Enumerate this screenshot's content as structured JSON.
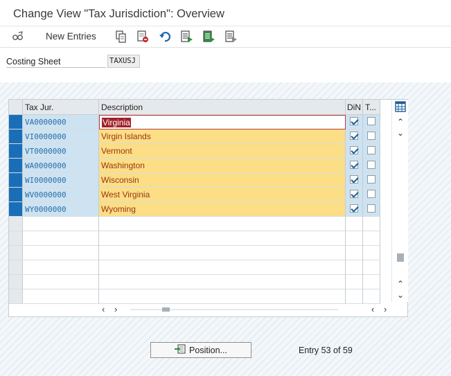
{
  "window": {
    "title": "Change View \"Tax Jurisdiction\": Overview"
  },
  "toolbar": {
    "new_entries_label": "New Entries",
    "icons": [
      "display-change-icon",
      "copy-icon",
      "delete-icon",
      "undo-icon",
      "select-all-icon",
      "select-block-icon",
      "deselect-all-icon"
    ]
  },
  "form": {
    "costing_sheet_label": "Costing Sheet",
    "costing_sheet_value": "TAXUSJ"
  },
  "table": {
    "headers": [
      "Tax Jur.",
      "Description",
      "DiN",
      "T..."
    ],
    "rows": [
      {
        "tax_jur": "VA0000000",
        "description": "Virginia",
        "din": true,
        "t": false
      },
      {
        "tax_jur": "VI0000000",
        "description": "Virgin Islands",
        "din": true,
        "t": false
      },
      {
        "tax_jur": "VT0000000",
        "description": "Vermont",
        "din": true,
        "t": false
      },
      {
        "tax_jur": "WA0000000",
        "description": "Washington",
        "din": true,
        "t": false
      },
      {
        "tax_jur": "WI0000000",
        "description": "Wisconsin",
        "din": true,
        "t": false
      },
      {
        "tax_jur": "WV0000000",
        "description": "West Virginia",
        "din": true,
        "t": false
      },
      {
        "tax_jur": "WY0000000",
        "description": "Wyoming",
        "din": true,
        "t": false
      }
    ],
    "empty_row_count": 6
  },
  "footer": {
    "position_label": "Position...",
    "entry_text": "Entry 53 of 59"
  },
  "colors": {
    "selection_blue": "#1a6eb8",
    "key_cell": "#cde3f2",
    "desc_cell": "#fbde85",
    "desc_text": "#9b3412"
  }
}
